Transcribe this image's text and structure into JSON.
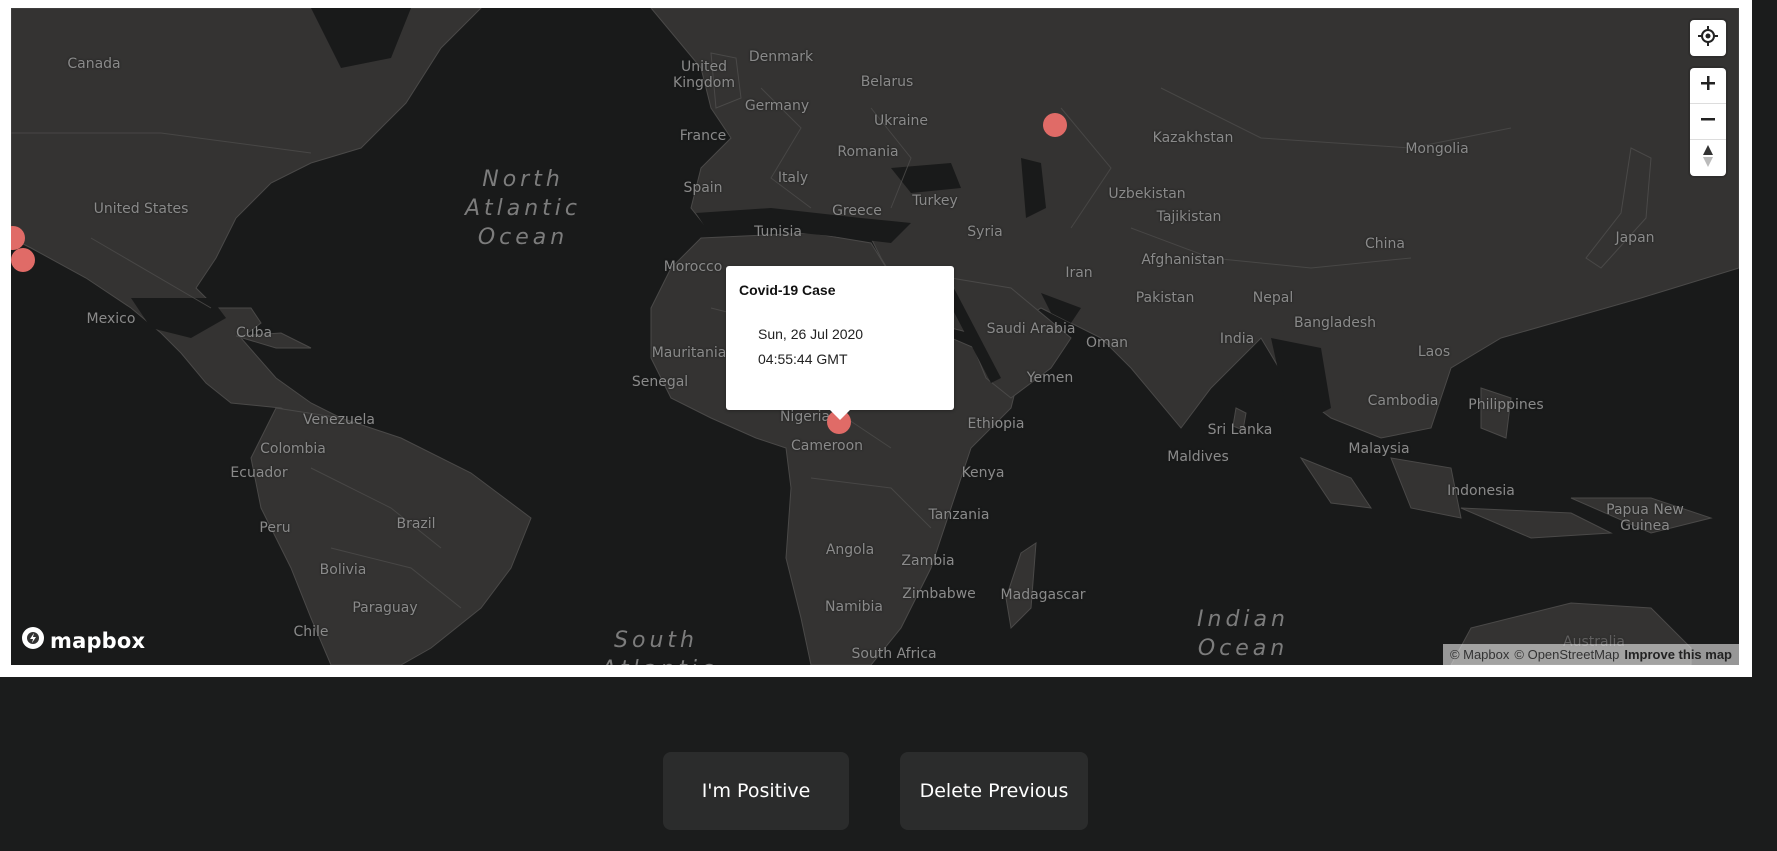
{
  "colors": {
    "page_bg": "#1b1c1c",
    "map_water": "#191a1a",
    "map_land": "#343332",
    "marker": "#e06b67",
    "button_bg": "#2b2c2c"
  },
  "map": {
    "country_labels": [
      "Canada",
      "United States",
      "Mexico",
      "Cuba",
      "Venezuela",
      "Colombia",
      "Ecuador",
      "Peru",
      "Brazil",
      "Bolivia",
      "Paraguay",
      "Chile",
      "Denmark",
      "United Kingdom",
      "Belarus",
      "Germany",
      "Ukraine",
      "France",
      "Romania",
      "Spain",
      "Italy",
      "Greece",
      "Turkey",
      "Tunisia",
      "Morocco",
      "Syria",
      "Iran",
      "Afghanistan",
      "Kazakhstan",
      "Uzbekistan",
      "Tajikistan",
      "Mongolia",
      "China",
      "Japan",
      "Pakistan",
      "Nepal",
      "Bangladesh",
      "India",
      "Saudi Arabia",
      "Oman",
      "Yemen",
      "Mauritania",
      "Senegal",
      "Nigeria",
      "Cameroon",
      "Ethiopia",
      "Kenya",
      "Tanzania",
      "Angola",
      "Zambia",
      "Zimbabwe",
      "Namibia",
      "Madagascar",
      "South Africa",
      "Sri Lanka",
      "Maldives",
      "Laos",
      "Cambodia",
      "Philippines",
      "Malaysia",
      "Indonesia",
      "Papua New Guinea",
      "Australia"
    ],
    "ocean_labels": [
      "North Atlantic Ocean",
      "South Atlantic Ocean",
      "Indian Ocean"
    ],
    "popup": {
      "title": "Covid-19 Case",
      "date": "Sun, 26 Jul 2020",
      "time": "04:55:44 GMT"
    },
    "controls": {
      "geolocate_icon": "crosshair-icon",
      "zoom_in_icon": "plus-icon",
      "zoom_out_icon": "minus-icon",
      "compass_icon": "compass-icon"
    },
    "logo": "mapbox",
    "attribution": {
      "mapbox": "© Mapbox",
      "osm": "© OpenStreetMap",
      "improve": "Improve this map"
    }
  },
  "actions": {
    "positive_label": "I'm Positive",
    "delete_label": "Delete Previous"
  }
}
